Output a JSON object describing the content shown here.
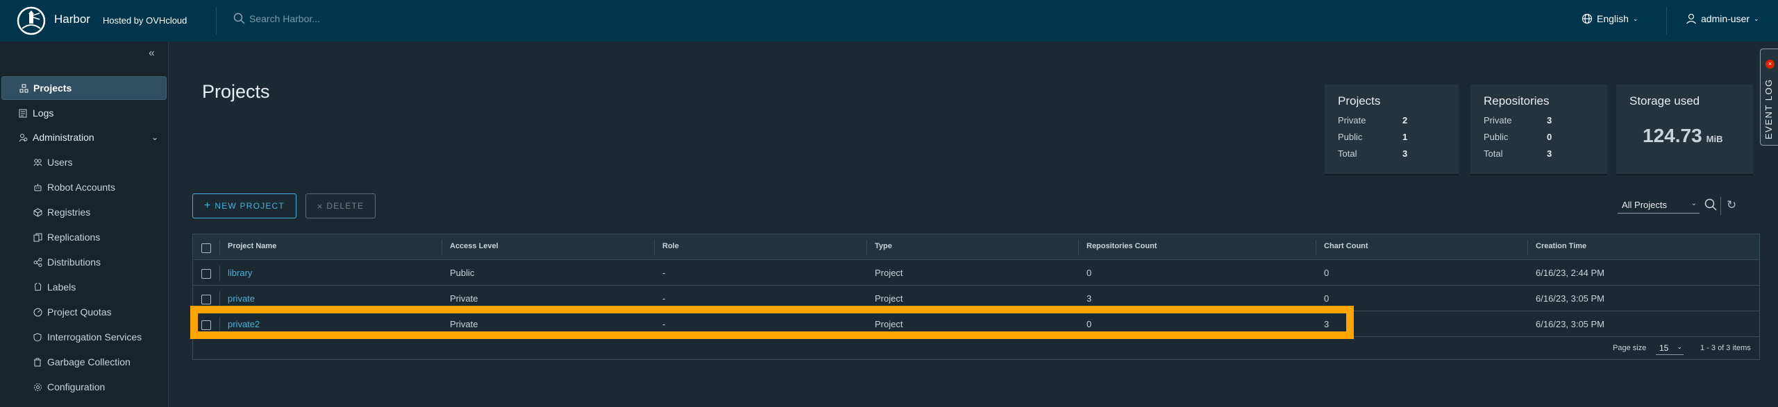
{
  "header": {
    "brand": "Harbor",
    "hosted_by": "Hosted by OVHcloud",
    "search_placeholder": "Search Harbor...",
    "language": "English",
    "user": "admin-user"
  },
  "sidebar": {
    "items": [
      {
        "label": "Projects",
        "icon": "projects-icon"
      },
      {
        "label": "Logs",
        "icon": "logs-icon"
      },
      {
        "label": "Administration",
        "icon": "administration-icon"
      }
    ],
    "admin_items": [
      {
        "label": "Users",
        "icon": "users-icon"
      },
      {
        "label": "Robot Accounts",
        "icon": "robot-icon"
      },
      {
        "label": "Registries",
        "icon": "registries-icon"
      },
      {
        "label": "Replications",
        "icon": "replications-icon"
      },
      {
        "label": "Distributions",
        "icon": "distributions-icon"
      },
      {
        "label": "Labels",
        "icon": "labels-icon"
      },
      {
        "label": "Project Quotas",
        "icon": "quotas-icon"
      },
      {
        "label": "Interrogation Services",
        "icon": "interrogation-icon"
      },
      {
        "label": "Garbage Collection",
        "icon": "trash-icon"
      },
      {
        "label": "Configuration",
        "icon": "gear-icon"
      }
    ]
  },
  "main": {
    "title": "Projects",
    "cards": {
      "projects": {
        "title": "Projects",
        "rows": [
          {
            "label": "Private",
            "value": "2"
          },
          {
            "label": "Public",
            "value": "1"
          },
          {
            "label": "Total",
            "value": "3"
          }
        ]
      },
      "repositories": {
        "title": "Repositories",
        "rows": [
          {
            "label": "Private",
            "value": "3"
          },
          {
            "label": "Public",
            "value": "0"
          },
          {
            "label": "Total",
            "value": "3"
          }
        ]
      },
      "storage": {
        "title": "Storage used",
        "value": "124.73",
        "unit": "MiB"
      }
    },
    "buttons": {
      "new_project": "NEW PROJECT",
      "delete": "DELETE"
    },
    "filter": "All Projects",
    "table": {
      "columns": [
        "Project Name",
        "Access Level",
        "Role",
        "Type",
        "Repositories Count",
        "Chart Count",
        "Creation Time"
      ],
      "rows": [
        [
          "library",
          "Public",
          "-",
          "Project",
          "0",
          "0",
          "6/16/23, 2:44 PM"
        ],
        [
          "private",
          "Private",
          "-",
          "Project",
          "3",
          "0",
          "6/16/23, 3:05 PM"
        ],
        [
          "private2",
          "Private",
          "-",
          "Project",
          "0",
          "3",
          "6/16/23, 3:05 PM"
        ]
      ],
      "page_size_label": "Page size",
      "page_size": "15",
      "range": "1 - 3 of 3 items"
    },
    "event_log": "EVENT LOG",
    "highlight_color": "#ffa500"
  }
}
